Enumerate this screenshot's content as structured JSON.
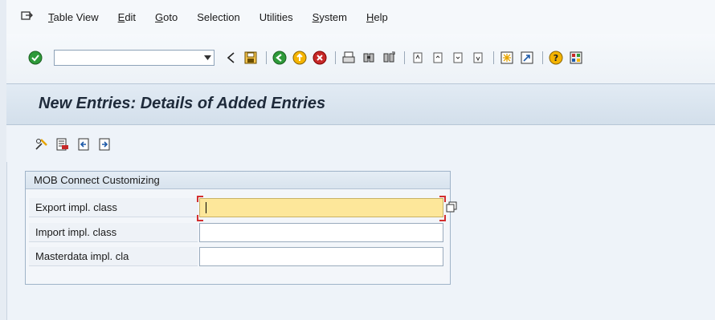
{
  "menu": {
    "items": [
      {
        "label": "Table View",
        "underline": "T",
        "rest": "able View"
      },
      {
        "label": "Edit",
        "underline": "E",
        "rest": "dit"
      },
      {
        "label": "Goto",
        "underline": "G",
        "rest": "oto"
      },
      {
        "label": "Selection",
        "underline": "",
        "rest": "Selection"
      },
      {
        "label": "Utilities",
        "underline": "",
        "rest": "Utilities"
      },
      {
        "label": "System",
        "underline": "S",
        "rest": "ystem"
      },
      {
        "label": "Help",
        "underline": "H",
        "rest": "elp"
      }
    ]
  },
  "toolbar": {
    "command_field_value": ""
  },
  "title": "New Entries: Details of Added Entries",
  "group": {
    "title": "MOB Connect Customizing",
    "fields": [
      {
        "label": "Export impl. class",
        "value": ""
      },
      {
        "label": "Import impl. class",
        "value": ""
      },
      {
        "label": "Masterdata impl. cla",
        "value": ""
      }
    ]
  },
  "colors": {
    "focused_field": "#fde79a",
    "title_text": "#1e2a3a",
    "accent_green": "#2e9a3a",
    "accent_red": "#c62828"
  }
}
